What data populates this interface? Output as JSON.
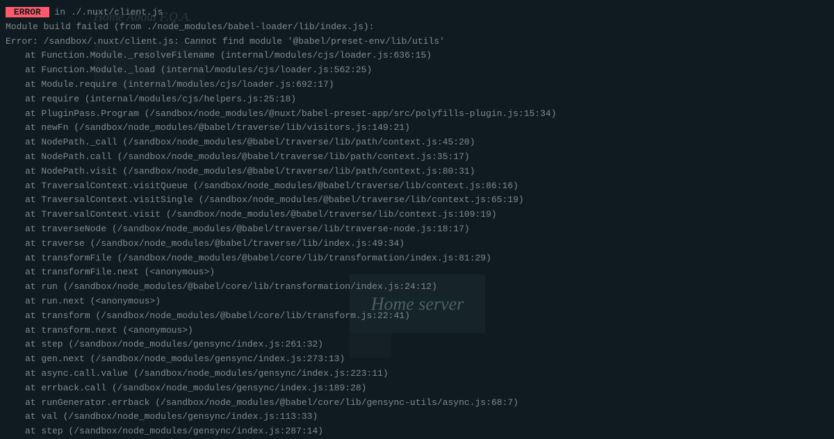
{
  "error_badge": " ERROR ",
  "error_in": " in ./.nuxt/client.js",
  "build_failed": "Module build failed (from ./node_modules/babel-loader/lib/index.js):",
  "error_msg": "Error: /sandbox/.nuxt/client.js: Cannot find module '@babel/preset-env/lib/utils'",
  "stack": [
    "at Function.Module._resolveFilename (internal/modules/cjs/loader.js:636:15)",
    "at Function.Module._load (internal/modules/cjs/loader.js:562:25)",
    "at Module.require (internal/modules/cjs/loader.js:692:17)",
    "at require (internal/modules/cjs/helpers.js:25:18)",
    "at PluginPass.Program (/sandbox/node_modules/@nuxt/babel-preset-app/src/polyfills-plugin.js:15:34)",
    "at newFn (/sandbox/node_modules/@babel/traverse/lib/visitors.js:149:21)",
    "at NodePath._call (/sandbox/node_modules/@babel/traverse/lib/path/context.js:45:20)",
    "at NodePath.call (/sandbox/node_modules/@babel/traverse/lib/path/context.js:35:17)",
    "at NodePath.visit (/sandbox/node_modules/@babel/traverse/lib/path/context.js:80:31)",
    "at TraversalContext.visitQueue (/sandbox/node_modules/@babel/traverse/lib/context.js:86:16)",
    "at TraversalContext.visitSingle (/sandbox/node_modules/@babel/traverse/lib/context.js:65:19)",
    "at TraversalContext.visit (/sandbox/node_modules/@babel/traverse/lib/context.js:109:19)",
    "at traverseNode (/sandbox/node_modules/@babel/traverse/lib/traverse-node.js:18:17)",
    "at traverse (/sandbox/node_modules/@babel/traverse/lib/index.js:49:34)",
    "at transformFile (/sandbox/node_modules/@babel/core/lib/transformation/index.js:81:29)",
    "at transformFile.next (<anonymous>)",
    "at run (/sandbox/node_modules/@babel/core/lib/transformation/index.js:24:12)",
    "at run.next (<anonymous>)",
    "at transform (/sandbox/node_modules/@babel/core/lib/transform.js:22:41)",
    "at transform.next (<anonymous>)",
    "at step (/sandbox/node_modules/gensync/index.js:261:32)",
    "at gen.next (/sandbox/node_modules/gensync/index.js:273:13)",
    "at async.call.value (/sandbox/node_modules/gensync/index.js:223:11)",
    "at errback.call (/sandbox/node_modules/gensync/index.js:189:28)",
    "at runGenerator.errback (/sandbox/node_modules/@babel/core/lib/gensync-utils/async.js:68:7)",
    "at val (/sandbox/node_modules/gensync/index.js:113:33)",
    "at step (/sandbox/node_modules/gensync/index.js:287:14)"
  ],
  "bg_nav": "Home   About   F.Q.A.",
  "bg_card": "Home server"
}
